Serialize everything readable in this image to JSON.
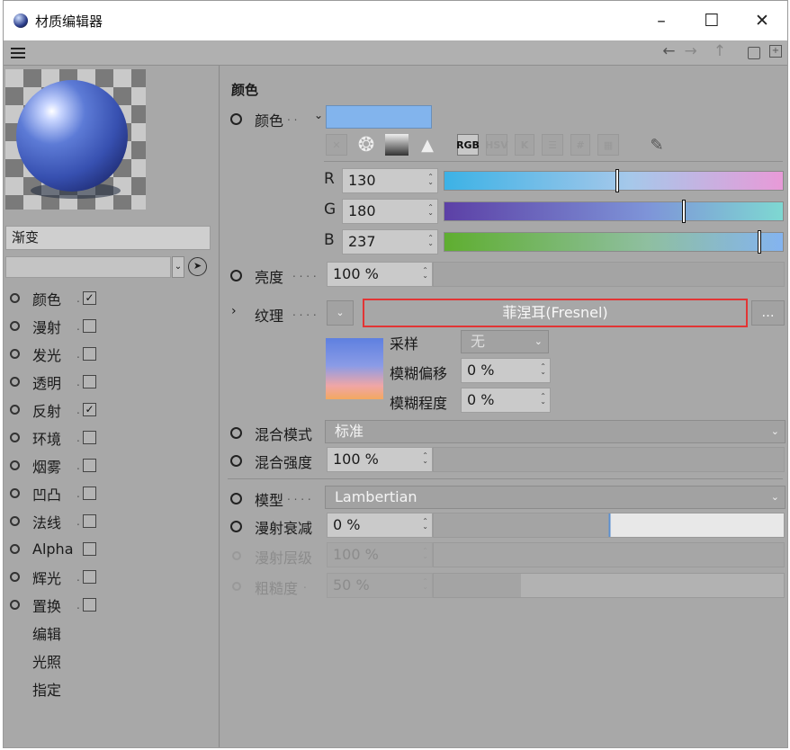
{
  "window": {
    "title": "材质编辑器",
    "min": "–",
    "max": "☐",
    "close": "✕"
  },
  "toolbar": {
    "back": "←",
    "forward": "→",
    "up": "↑",
    "lock": "🔒",
    "newwin": "⊞"
  },
  "left": {
    "material_name": "渐变",
    "channels": [
      {
        "label": "颜色",
        "checked": true
      },
      {
        "label": "漫射",
        "checked": false
      },
      {
        "label": "发光",
        "checked": false
      },
      {
        "label": "透明",
        "checked": false
      },
      {
        "label": "反射",
        "checked": true
      },
      {
        "label": "环境",
        "checked": false
      },
      {
        "label": "烟雾",
        "checked": false
      },
      {
        "label": "凹凸",
        "checked": false
      },
      {
        "label": "法线",
        "checked": false
      },
      {
        "label": "Alpha",
        "checked": false
      },
      {
        "label": "辉光",
        "checked": false
      },
      {
        "label": "置换",
        "checked": false
      }
    ],
    "extra": [
      "编辑",
      "光照",
      "指定"
    ]
  },
  "right": {
    "section": "颜色",
    "color_label": "颜色",
    "color_hex": "#82b4ed",
    "icons": {
      "rgb": "RGB",
      "hsv": "HSV",
      "k": "K",
      "hash": "#"
    },
    "r": {
      "label": "R",
      "value": "130"
    },
    "g": {
      "label": "G",
      "value": "180"
    },
    "b": {
      "label": "B",
      "value": "237"
    },
    "brightness": {
      "label": "亮度",
      "value": "100 %"
    },
    "texture": {
      "label": "纹理",
      "shader": "菲涅耳(Fresnel)",
      "more": "..."
    },
    "sampling": {
      "label": "采样",
      "value": "无"
    },
    "blur_offset": {
      "label": "模糊偏移",
      "value": "0 %"
    },
    "blur_scale": {
      "label": "模糊程度",
      "value": "0 %"
    },
    "mix_mode": {
      "label": "混合模式",
      "value": "标准"
    },
    "mix_strength": {
      "label": "混合强度",
      "value": "100 %"
    },
    "model": {
      "label": "模型",
      "value": "Lambertian"
    },
    "diffuse_falloff": {
      "label": "漫射衰减",
      "value": "0 %"
    },
    "diffuse_level": {
      "label": "漫射层级",
      "value": "100 %"
    },
    "roughness": {
      "label": "粗糙度",
      "value": "50 %"
    }
  }
}
